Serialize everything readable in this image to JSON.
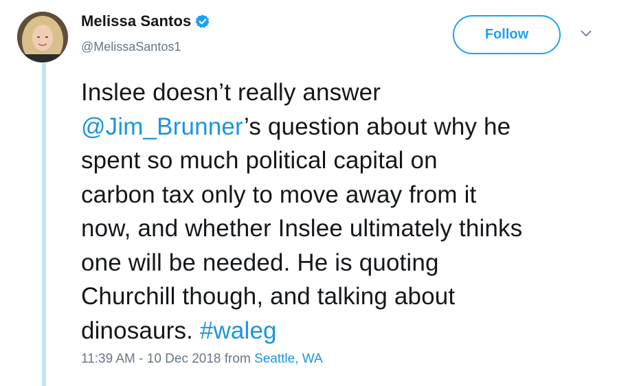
{
  "author": {
    "display_name": "Melissa Santos",
    "handle": "@MelissaSantos1",
    "verified_icon": "verified-badge-icon"
  },
  "actions": {
    "follow_label": "Follow",
    "more_icon": "chevron-down-icon"
  },
  "tweet": {
    "lines": [
      [
        {
          "text": "Inslee doesn’t really answer"
        }
      ],
      [
        {
          "text": "@Jim_Brunner",
          "link": true
        },
        {
          "text": "’s question about why he"
        }
      ],
      [
        {
          "text": "spent so much political capital on"
        }
      ],
      [
        {
          "text": "carbon tax only to move away from it"
        }
      ],
      [
        {
          "text": "now, and whether Inslee ultimately thinks"
        }
      ],
      [
        {
          "text": "one will be needed. He is quoting"
        }
      ],
      [
        {
          "text": "Churchill though, and talking about"
        }
      ],
      [
        {
          "text": "dinosaurs. "
        },
        {
          "text": "#waleg",
          "link": true
        }
      ]
    ]
  },
  "meta": {
    "timestamp": "11:39 AM - 10 Dec 2018",
    "from_label": "from",
    "location": "Seattle, WA"
  },
  "colors": {
    "accent": "#1da1f2",
    "link": "#1b95e0",
    "muted": "#657786",
    "thread_line": "#c4e2f2"
  }
}
